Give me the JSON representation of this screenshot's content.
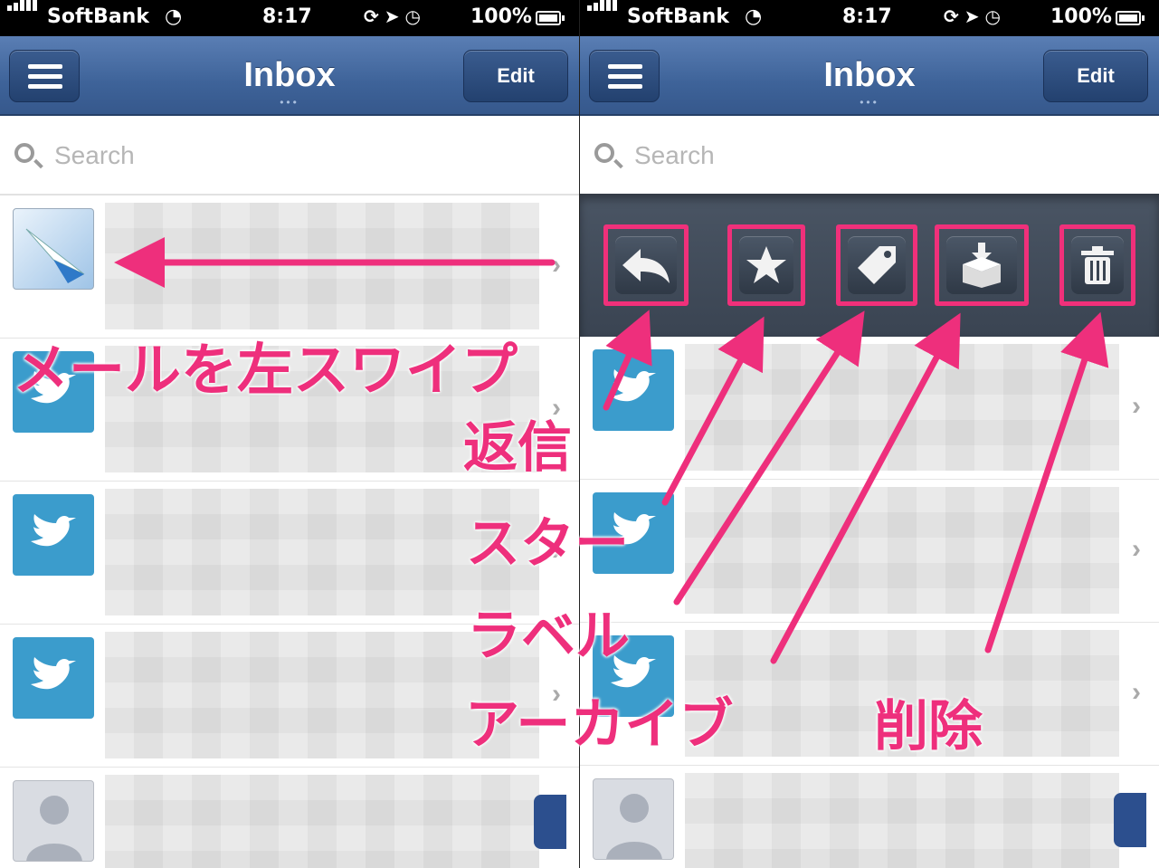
{
  "status_bar": {
    "carrier": "SoftBank",
    "time": "8:17",
    "battery": "100%"
  },
  "nav": {
    "title": "Inbox",
    "edit_label": "Edit"
  },
  "search": {
    "placeholder": "Search"
  },
  "actions": [
    {
      "name": "reply",
      "icon": "reply-icon"
    },
    {
      "name": "star",
      "icon": "star-icon"
    },
    {
      "name": "label",
      "icon": "tag-icon"
    },
    {
      "name": "archive",
      "icon": "archive-icon"
    },
    {
      "name": "delete",
      "icon": "trash-icon"
    }
  ],
  "annotations": {
    "swipe": "メールを左スワイプ",
    "reply": "返信",
    "star": "スター",
    "label": "ラベル",
    "archive": "アーカイブ",
    "delete": "削除"
  },
  "colors": {
    "annotation": "#ee2f7c",
    "navbar": "#3e6399",
    "twitter": "#3b9ccc"
  }
}
